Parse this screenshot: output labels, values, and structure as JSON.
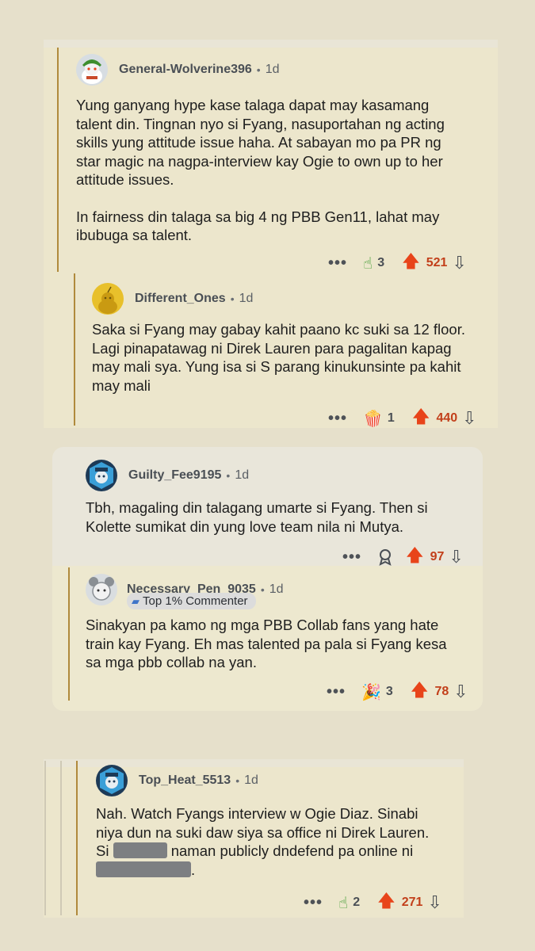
{
  "comments": [
    {
      "username": "General-Wolverine396",
      "age": "1d",
      "lines": [
        "Yung ganyang hype kase talaga dapat may kasamang",
        "talent din. Tingnan nyo si Fyang, nasuportahan ng acting",
        "skills yung attitude issue haha. At sabayan mo pa PR ng",
        "star magic na nagpa-interview kay Ogie to own up to her",
        "attitude issues."
      ],
      "lines2": [
        "In fairness din talaga sa big 4 ng PBB Gen11, lahat may",
        "ibubuga sa talent."
      ],
      "award_count": "3",
      "score": "521"
    },
    {
      "username": "Different_Ones",
      "age": "1d",
      "lines": [
        "Saka si Fyang may gabay kahit paano kc suki sa 12 floor.",
        "Lagi pinapatawag ni Direk Lauren para pagalitan kapag",
        "may mali sya. Yung isa si S parang kinukunsinte pa kahit",
        "may mali"
      ],
      "award_count": "1",
      "score": "440"
    },
    {
      "username": "Guilty_Fee9195",
      "age": "1d",
      "lines": [
        "Tbh, magaling din talagang umarte si Fyang. Then si",
        "Kolette sumikat din yung love team nila ni Mutya."
      ],
      "score": "97"
    },
    {
      "username": "Necessary_Pen_9035",
      "age": "1d",
      "badge": "Top 1% Commenter",
      "lines": [
        "Sinakyan pa kamo ng mga PBB Collab fans yang hate",
        "train kay Fyang. Eh mas talented pa pala si Fyang kesa",
        "sa mga pbb collab na yan."
      ],
      "award_count": "3",
      "score": "78"
    },
    {
      "username": "Top_Heat_5513",
      "age": "1d",
      "line1": "Nah. Watch Fyangs interview w Ogie Diaz. Sinabi",
      "line2": "niya dun na suki daw siya sa office ni Direk Lauren.",
      "line3a": "Si",
      "line3b": "naman publicly dndefend pa online ni",
      "line4": ".",
      "award_count": "2",
      "score": "271"
    }
  ],
  "ui": {
    "more_label": "•••",
    "dot": "•",
    "upvote_icon": "upvote-arrow",
    "downvote_icon": "downvote-arrow"
  },
  "colors": {
    "background": "#e6e0cb",
    "upvote": "#e8441a",
    "score": "#c23f1a",
    "thread_line": "#b08a3c"
  }
}
